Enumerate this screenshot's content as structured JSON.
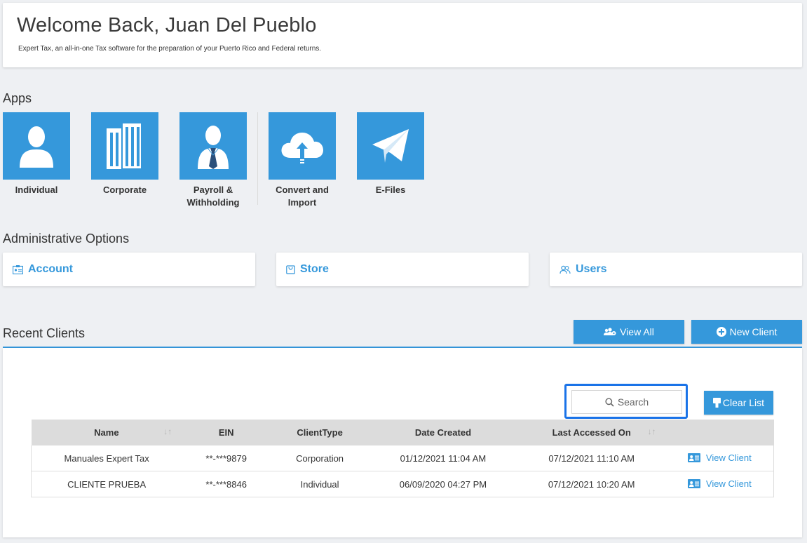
{
  "welcome": {
    "title": "Welcome Back, Juan Del Pueblo",
    "subtitle": "Expert Tax, an all-in-one Tax software for the preparation of your Puerto Rico and Federal returns."
  },
  "apps": {
    "heading": "Apps",
    "items": [
      {
        "label": "Individual",
        "icon": "person-icon"
      },
      {
        "label": "Corporate",
        "icon": "buildings-icon"
      },
      {
        "label_line1": "Payroll &",
        "label_line2": "Withholding",
        "icon": "businessman-icon"
      },
      {
        "label_line1": "Convert and",
        "label_line2": "Import",
        "icon": "cloud-upload-icon"
      },
      {
        "label": "E-Files",
        "icon": "paper-plane-icon"
      }
    ]
  },
  "admin": {
    "heading": "Administrative Options",
    "items": [
      {
        "label": "Account",
        "icon": "id-card-icon"
      },
      {
        "label": "Store",
        "icon": "shopping-bag-icon"
      },
      {
        "label": "Users",
        "icon": "users-icon"
      }
    ]
  },
  "clients": {
    "heading": "Recent Clients",
    "view_all_label": "View All",
    "new_client_label": "New Client",
    "search_placeholder": "Search",
    "clear_list_label": "Clear List",
    "columns": [
      "Name",
      "EIN",
      "ClientType",
      "Date Created",
      "Last Accessed On",
      ""
    ],
    "rows": [
      {
        "name": "Manuales Expert Tax",
        "ein": "**-***9879",
        "type": "Corporation",
        "created": "01/12/2021 11:04 AM",
        "accessed": "07/12/2021 11:10 AM",
        "action": "View Client"
      },
      {
        "name": "CLIENTE PRUEBA",
        "ein": "**-***8846",
        "type": "Individual",
        "created": "06/09/2020 04:27 PM",
        "accessed": "07/12/2021 10:20 AM",
        "action": "View Client"
      }
    ]
  },
  "colors": {
    "accent": "#3598db",
    "background": "#eef0f3",
    "header_row": "#dcdcdc",
    "search_highlight": "#1a73e8"
  }
}
